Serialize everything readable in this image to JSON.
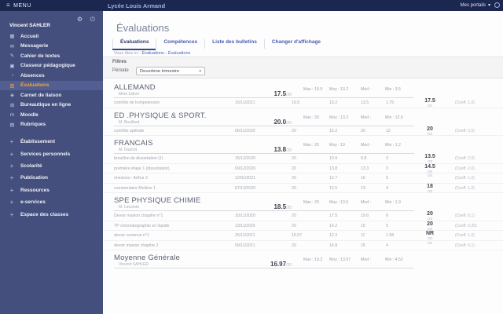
{
  "topbar": {
    "menu_label": "MENU",
    "school_title": "Lycée Louis Armand",
    "portals_label": "Mes portails"
  },
  "icons": {
    "hamburger": "≡",
    "chevron_down": "▾",
    "settings": "⚙",
    "power": "⏻"
  },
  "sidebar": {
    "user_name": "Vincent SAHLER",
    "items": [
      {
        "label": "Accueil",
        "icon": "▦"
      },
      {
        "label": "Messagerie",
        "icon": "✉"
      },
      {
        "label": "Cahier de textes",
        "icon": "✎"
      },
      {
        "label": "Classeur pédagogique",
        "icon": "▣"
      },
      {
        "label": "Absences",
        "icon": "◔"
      },
      {
        "label": "Évaluations",
        "icon": "▥",
        "active": true
      },
      {
        "label": "Carnet de liaison",
        "icon": "◈"
      },
      {
        "label": "Bureautique en ligne",
        "icon": "⊞"
      },
      {
        "label": "Moodle",
        "icon": "m"
      },
      {
        "label": "Rubriques",
        "icon": "▤"
      }
    ],
    "sections": [
      {
        "plus": "+",
        "label": "Établissement"
      },
      {
        "plus": "+",
        "label": "Services personnels"
      },
      {
        "plus": "+",
        "label": "Scolarité"
      },
      {
        "plus": "+",
        "label": "Publication"
      },
      {
        "plus": "+",
        "label": "Ressources"
      },
      {
        "plus": "+",
        "label": "e-services"
      },
      {
        "plus": "+",
        "label": "Espace des classes"
      }
    ]
  },
  "main": {
    "title": "Évaluations",
    "tabs": [
      {
        "label": "Évaluations",
        "active": true
      },
      {
        "label": "Compétences"
      },
      {
        "label": "Liste des bulletins"
      },
      {
        "label": "Changer d'affichage"
      }
    ],
    "breadcrumb": {
      "prefix": "Vous êtes ici :",
      "home": "Évaluations",
      "sep": "›",
      "current": "Évaluations"
    },
    "filters": {
      "title": "Filtres",
      "period_label": "Période",
      "period_value": "Deuxième trimestre"
    },
    "subjects": [
      {
        "name": "ALLEMAND",
        "teacher": "Mme Littner",
        "average": "17.5",
        "outof": "/20",
        "stats": {
          "max": "Max : 19.5",
          "moy": "Moy : 13.2",
          "med": "Med :",
          "min": "Min : 3.5"
        },
        "rows": [
          {
            "title": "contrôle de kompetenzen",
            "date": "15/11/2021",
            "max": "19.5",
            "moy": "13.2",
            "med": "13.5",
            "min": "1.75",
            "note": "17.5",
            "outof": "/20",
            "coeff": "(Coeff. 1,0)"
          }
        ]
      },
      {
        "name": "ED .PHYSIQUE & SPORT.",
        "teacher": "M. Bouillard",
        "average": "20.0",
        "outof": "/20",
        "stats": {
          "max": "Max : 20",
          "moy": "Moy : 13.2",
          "med": "Med :",
          "min": "Min : 12.6"
        },
        "rows": [
          {
            "title": "contrôle aptitude",
            "date": "06/11/2020",
            "max": "20",
            "moy": "15.2",
            "med": "20",
            "min": "12",
            "note": "20",
            "outof": "/20",
            "coeff": "(Coeff. 0,5)"
          }
        ]
      },
      {
        "name": "FRANCAIS",
        "teacher": "M. Dupont",
        "average": "13.8",
        "outof": "/20",
        "stats": {
          "max": "Max : 20",
          "moy": "Moy : 10",
          "med": "Med :",
          "min": "Min : 1.2"
        },
        "rows": [
          {
            "title": "brouillon de dissertation (1)",
            "date": "15/12/2020",
            "max": "20",
            "moy": "10.9",
            "med": "9.8",
            "min": "3",
            "note": "13.5",
            "outof": "/20",
            "coeff": "(Coeff. 2,0)"
          },
          {
            "title": "première étape 1 (dissertation)",
            "date": "09/12/2020",
            "max": "20",
            "moy": "13.8",
            "med": "13.3",
            "min": "3",
            "note": "14.5",
            "outof": "/20",
            "coeff": "(Coeff. 2,0)"
          },
          {
            "title": "révisions : Arthur 2",
            "date": "12/01/2021",
            "max": "20",
            "moy": "12.7",
            "med": "16",
            "min": "5",
            "note": "",
            "outof": "/20",
            "coeff": "(Coeff. 1,0)"
          },
          {
            "title": "commentaire Molière 1",
            "date": "07/12/2020",
            "max": "20",
            "moy": "12.5",
            "med": "13",
            "min": "4",
            "note": "18",
            "outof": "/20",
            "coeff": "(Coeff. 1,0)"
          }
        ]
      },
      {
        "name": "SPE PHYSIQUE CHIMIE",
        "teacher": "M. Lecomte",
        "average": "18.5",
        "outof": "/20",
        "stats": {
          "max": "Max : 20",
          "moy": "Moy : 13.6",
          "med": "Med :",
          "min": "Min : 1.9"
        },
        "rows": [
          {
            "title": "Devoir maison chapitre n°1",
            "date": "10/11/2020",
            "max": "20",
            "moy": "17.5",
            "med": "19.6",
            "min": "6",
            "note": "20",
            "outof": "/20",
            "coeff": "(Coeff. 0,1)"
          },
          {
            "title": "TP chromatographie en liquide",
            "date": "13/11/2020",
            "max": "20",
            "moy": "14.2",
            "med": "15",
            "min": "5",
            "note": "20",
            "outof": "/20",
            "coeff": "(Coeff. 0,25)"
          },
          {
            "title": "devoir commun n°1",
            "date": "25/11/2021",
            "max": "16.57",
            "moy": "12.3",
            "med": "11",
            "min": "1.58",
            "note": "NR",
            "outof": "/20",
            "coeff": "(Coeff. 1,0)"
          },
          {
            "title": "devoir maison chapitre 2",
            "date": "09/11/2021",
            "max": "20",
            "moy": "14.8",
            "med": "15",
            "min": "4",
            "note": "",
            "outof": "/20",
            "coeff": "(Coeff. 0,1)"
          }
        ]
      },
      {
        "name": "Moyenne Générale",
        "teacher": "Vincent SAHLER",
        "average": "16.97",
        "outof": "/20",
        "stats": {
          "max": "Max : 19.2",
          "moy": "Moy : 13.57",
          "med": "Med :",
          "min": "Min : 4.52"
        },
        "rows": []
      }
    ]
  }
}
